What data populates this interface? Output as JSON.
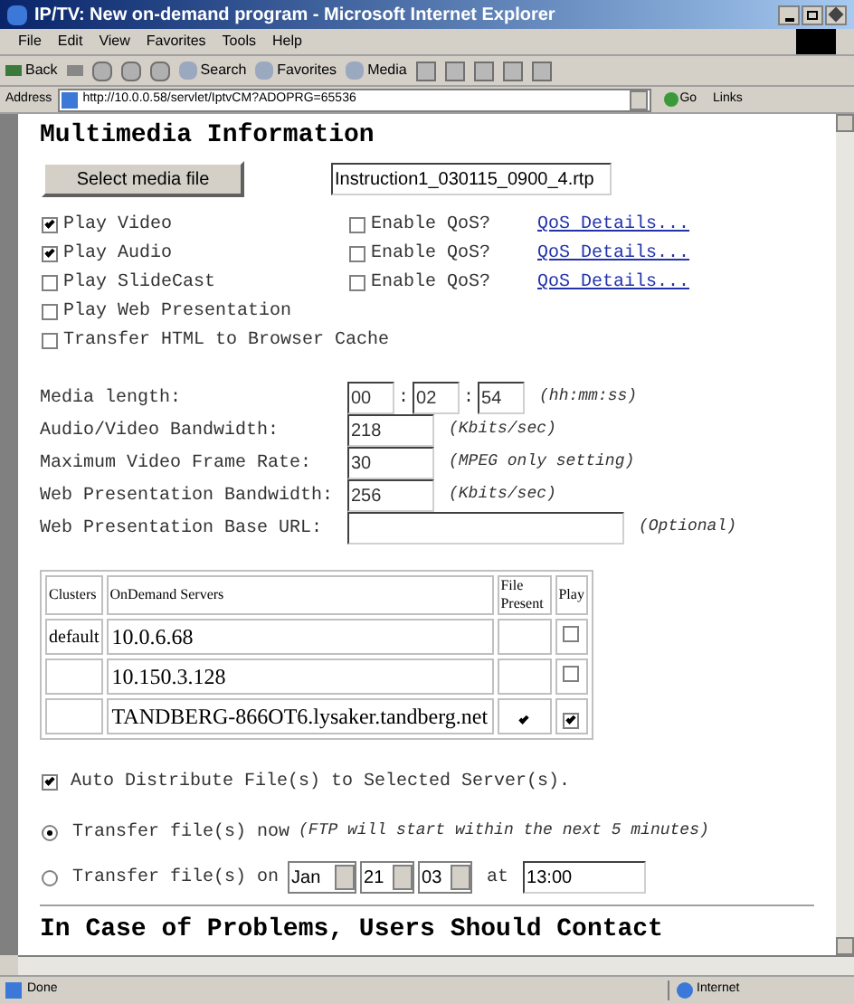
{
  "window": {
    "title": "IP/TV: New on-demand program - Microsoft Internet Explorer"
  },
  "menu": [
    "File",
    "Edit",
    "View",
    "Favorites",
    "Tools",
    "Help"
  ],
  "toolbar": {
    "back": "Back",
    "search": "Search",
    "favorites": "Favorites",
    "media": "Media"
  },
  "address": {
    "label": "Address",
    "url": "http://10.0.0.58/servlet/IptvCM?ADOPRG=65536",
    "go": "Go",
    "links": "Links"
  },
  "page": {
    "heading": "Multimedia Information",
    "select_button": "Select media file",
    "media_file": "Instruction1_030115_0900_4.rtp",
    "options": [
      {
        "label": "Play Video",
        "checked": true,
        "qos": {
          "label": "Enable QoS?",
          "checked": false
        },
        "link": "QoS Details..."
      },
      {
        "label": "Play Audio",
        "checked": true,
        "qos": {
          "label": "Enable QoS?",
          "checked": false
        },
        "link": "QoS Details..."
      },
      {
        "label": "Play SlideCast",
        "checked": false,
        "qos": {
          "label": "Enable QoS?",
          "checked": false
        },
        "link": "QoS Details..."
      },
      {
        "label": "Play Web Presentation",
        "checked": false
      },
      {
        "label": "Transfer HTML to Browser Cache",
        "checked": false
      }
    ],
    "media_length": {
      "label": "Media length:",
      "hh": "00",
      "separators": [
        ":",
        ":"
      ],
      "mm": "02",
      "ss": "54",
      "hint": "(hh:mm:ss)"
    },
    "fields": [
      {
        "kind": "short",
        "label": "Audio/Video Bandwidth:",
        "value": "218",
        "hint": "(Kbits/sec)"
      },
      {
        "kind": "short",
        "label": "Maximum Video Frame Rate:",
        "value": "30",
        "hint": "(MPEG only setting)"
      },
      {
        "kind": "short",
        "label": "Web Presentation Bandwidth:",
        "value": "256",
        "hint": "(Kbits/sec)"
      },
      {
        "kind": "wide",
        "label": "Web Presentation Base URL:",
        "hint": "(Optional)"
      }
    ],
    "servers": {
      "columns": [
        "Clusters",
        "OnDemand Servers",
        "File Present",
        "Play"
      ],
      "rows": [
        {
          "cluster": "default",
          "server": "10.0.6.68",
          "file_present": false,
          "play": false
        },
        {
          "cluster": "",
          "server": "10.150.3.128",
          "file_present": false,
          "play": false
        },
        {
          "cluster": "",
          "server": "TANDBERG-866OT6.lysaker.tandberg.net",
          "file_present": true,
          "play": true
        }
      ]
    },
    "auto_distribute": {
      "label": "Auto Distribute File(s) to Selected Server(s).",
      "checked": true
    },
    "transfer": [
      {
        "kind": "now",
        "label": "Transfer file(s) now",
        "note": "(FTP will start within the next 5 minutes)",
        "selected": true
      },
      {
        "kind": "scheduled",
        "label": "Transfer file(s) on",
        "month": "Jan",
        "day": "21",
        "year": "03",
        "at": "at",
        "time": "13:00",
        "selected": false
      }
    ],
    "footer_heading": "In Case of Problems, Users Should Contact"
  },
  "status_bar": {
    "text": "Done",
    "zone": "Internet"
  }
}
